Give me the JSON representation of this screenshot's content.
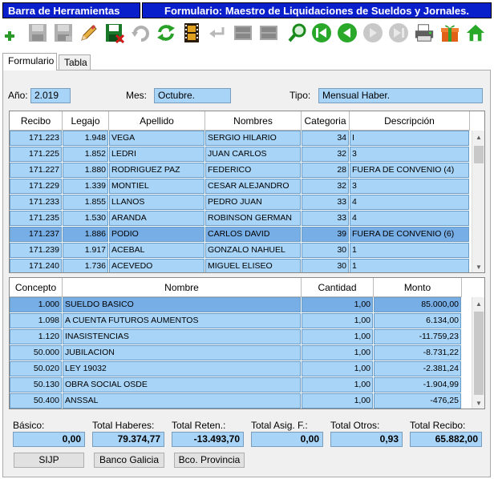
{
  "titlebar": {
    "section": "Barra de Herramientas",
    "form_title": "Formulario: Maestro de Liquidaciones de Sueldos y Jornales."
  },
  "toolbar": {
    "buttons": [
      "add-icon",
      "save-disabled-icon",
      "save-as-disabled-icon",
      "edit-icon",
      "save-icon",
      "undo-disabled-icon",
      "refresh-icon",
      "film-icon",
      "return-disabled-icon",
      "grid-disabled-icon",
      "grid2-disabled-icon",
      "search-icon",
      "first-icon",
      "prev-icon",
      "next-disabled-icon",
      "last-disabled-icon",
      "print-icon",
      "gift-icon",
      "home-icon"
    ]
  },
  "tabs": [
    {
      "label": "Formulario"
    },
    {
      "label": "Tabla"
    }
  ],
  "filters": {
    "anio_label": "Año:",
    "anio_value": "2.019",
    "mes_label": "Mes:",
    "mes_value": "Octubre.",
    "tipo_label": "Tipo:",
    "tipo_value": "Mensual Haber."
  },
  "recibos": {
    "headers": [
      "Recibo",
      "Legajo",
      "Apellido",
      "Nombres",
      "Categoria",
      "Descripción"
    ],
    "rows": [
      {
        "recibo": "171.223",
        "legajo": "1.948",
        "apellido": "VEGA",
        "nombres": "SERGIO HILARIO",
        "categoria": "34",
        "descripcion": "I"
      },
      {
        "recibo": "171.225",
        "legajo": "1.852",
        "apellido": "LEDRI",
        "nombres": "JUAN CARLOS",
        "categoria": "32",
        "descripcion": "3"
      },
      {
        "recibo": "171.227",
        "legajo": "1.880",
        "apellido": "RODRIGUEZ PAZ",
        "nombres": "FEDERICO",
        "categoria": "28",
        "descripcion": "FUERA DE CONVENIO (4)"
      },
      {
        "recibo": "171.229",
        "legajo": "1.339",
        "apellido": "MONTIEL",
        "nombres": "CESAR ALEJANDRO",
        "categoria": "32",
        "descripcion": "3"
      },
      {
        "recibo": "171.233",
        "legajo": "1.855",
        "apellido": "LLANOS",
        "nombres": "PEDRO JUAN",
        "categoria": "33",
        "descripcion": "4"
      },
      {
        "recibo": "171.235",
        "legajo": "1.530",
        "apellido": "ARANDA",
        "nombres": "ROBINSON GERMAN",
        "categoria": "33",
        "descripcion": "4"
      },
      {
        "recibo": "171.237",
        "legajo": "1.886",
        "apellido": "PODIO",
        "nombres": "CARLOS DAVID",
        "categoria": "39",
        "descripcion": "FUERA DE CONVENIO (6)",
        "selected": true
      },
      {
        "recibo": "171.239",
        "legajo": "1.917",
        "apellido": "ACEBAL",
        "nombres": "GONZALO NAHUEL",
        "categoria": "30",
        "descripcion": "1"
      },
      {
        "recibo": "171.240",
        "legajo": "1.736",
        "apellido": "ACEVEDO",
        "nombres": "MIGUEL ELISEO",
        "categoria": "30",
        "descripcion": "1"
      }
    ]
  },
  "conceptos": {
    "headers": [
      "Concepto",
      "Nombre",
      "Cantidad",
      "Monto"
    ],
    "rows": [
      {
        "concepto": "1.000",
        "nombre": "SUELDO BASICO",
        "cantidad": "1,00",
        "monto": "85.000,00",
        "selected": true
      },
      {
        "concepto": "1.098",
        "nombre": "A CUENTA FUTUROS AUMENTOS",
        "cantidad": "1,00",
        "monto": "6.134,00"
      },
      {
        "concepto": "1.120",
        "nombre": "INASISTENCIAS",
        "cantidad": "1,00",
        "monto": "-11.759,23"
      },
      {
        "concepto": "50.000",
        "nombre": "JUBILACION",
        "cantidad": "1,00",
        "monto": "-8.731,22"
      },
      {
        "concepto": "50.020",
        "nombre": "LEY 19032",
        "cantidad": "1,00",
        "monto": "-2.381,24"
      },
      {
        "concepto": "50.130",
        "nombre": "OBRA SOCIAL OSDE",
        "cantidad": "1,00",
        "monto": "-1.904,99"
      },
      {
        "concepto": "50.400",
        "nombre": "ANSSAL",
        "cantidad": "1,00",
        "monto": "-476,25"
      }
    ]
  },
  "totales": {
    "basico_label": "Básico:",
    "basico_value": "0,00",
    "haberes_label": "Total Haberes:",
    "haberes_value": "79.374,77",
    "reten_label": "Total Reten.:",
    "reten_value": "-13.493,70",
    "asig_label": "Total Asig. F.:",
    "asig_value": "0,00",
    "otros_label": "Total Otros:",
    "otros_value": "0,93",
    "recibo_label": "Total Recibo:",
    "recibo_value": "65.882,00"
  },
  "actions": {
    "sijp": "SIJP",
    "galicia": "Banco Galicia",
    "provincia": "Bco. Provincia"
  }
}
